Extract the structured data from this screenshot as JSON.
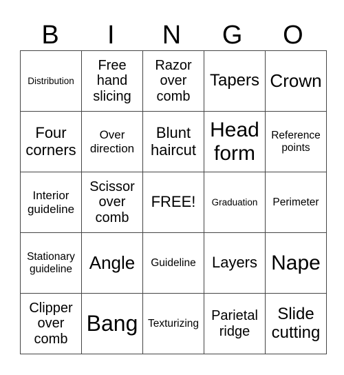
{
  "header": [
    "B",
    "I",
    "N",
    "G",
    "O"
  ],
  "rows": [
    [
      "Distribution",
      "Free hand slicing",
      "Razor over comb",
      "Tapers",
      "Crown"
    ],
    [
      "Four corners",
      "Over direction",
      "Blunt haircut",
      "Head form",
      "Reference points"
    ],
    [
      "Interior guideline",
      "Scissor over comb",
      "FREE!",
      "Graduation",
      "Perimeter"
    ],
    [
      "Stationary guideline",
      "Angle",
      "Guideline",
      "Layers",
      "Nape"
    ],
    [
      "Clipper over comb",
      "Bang",
      "Texturizing",
      "Parietal ridge",
      "Slide cutting"
    ]
  ]
}
